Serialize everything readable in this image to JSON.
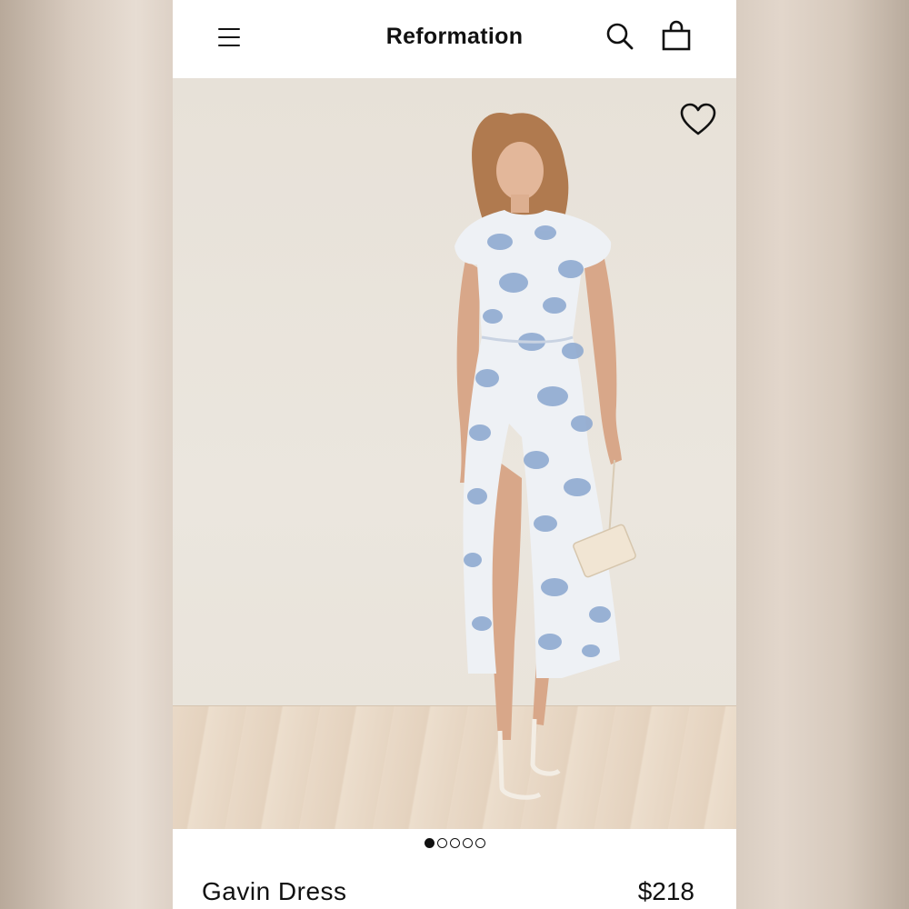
{
  "header": {
    "brand": "Reformation",
    "menu_icon": "hamburger-menu-icon",
    "search_icon": "search-icon",
    "bag_icon": "shopping-bag-icon"
  },
  "product": {
    "name": "Gavin Dress",
    "price": "$218",
    "favorite_icon": "heart-icon",
    "image_description_icon": "product-photo"
  },
  "carousel": {
    "total": 5,
    "active_index": 0
  },
  "colors": {
    "page_background": "#d9cdc1",
    "text": "#111111",
    "dress_blue": "#8aa6cf"
  }
}
